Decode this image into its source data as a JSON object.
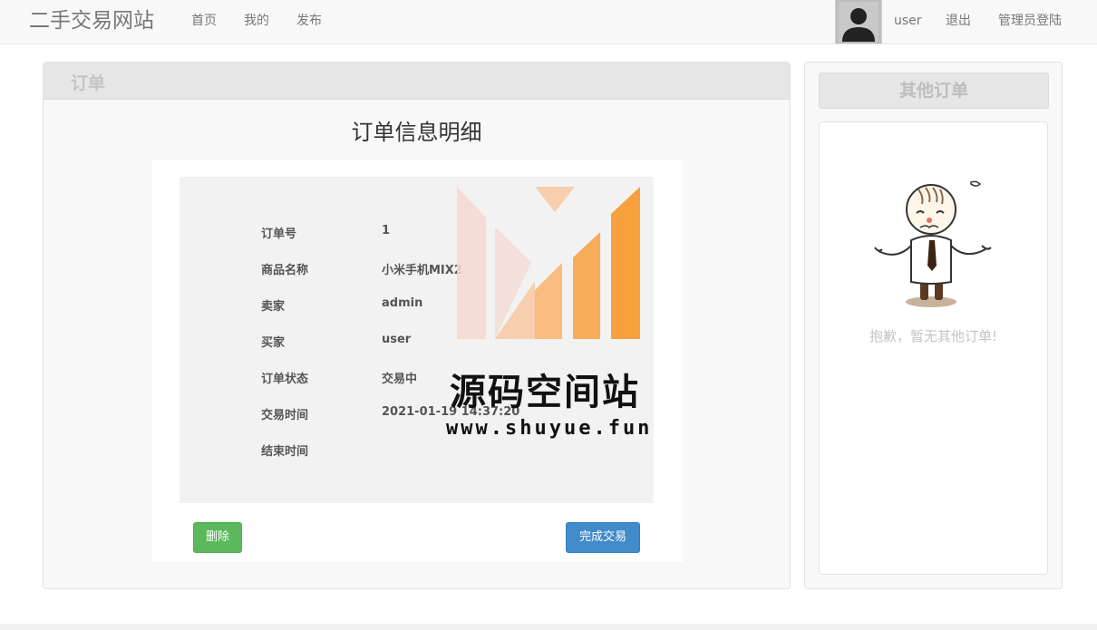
{
  "navbar": {
    "brand": "二手交易网站",
    "links": {
      "home": "首页",
      "mine": "我的",
      "publish": "发布"
    },
    "username": "user",
    "logout": "退出",
    "admin_login": "管理员登陆",
    "avatar_icon": "user-avatar-icon"
  },
  "main_panel": {
    "heading": "订单",
    "title": "订单信息明细",
    "rows": [
      {
        "label": "订单号",
        "value": "1"
      },
      {
        "label": "商品名称",
        "value": "小米手机MIX2"
      },
      {
        "label": "卖家",
        "value": "admin"
      },
      {
        "label": "买家",
        "value": "user"
      },
      {
        "label": "订单状态",
        "value": "交易中"
      },
      {
        "label": "交易时间",
        "value": "2021-01-19 14:37:20"
      },
      {
        "label": "结束时间",
        "value": ""
      }
    ],
    "buttons": {
      "delete": "删除",
      "complete": "完成交易"
    }
  },
  "side_panel": {
    "heading": "其他订单",
    "empty_message": "抱歉，暂无其他订单!",
    "illustration_icon": "shrugging-man-illustration"
  },
  "watermark": {
    "title": "源码空间站",
    "url": "www.shuyue.fun"
  },
  "colors": {
    "delete_button": "#5cb85c",
    "complete_button": "#428bca",
    "navbar_bg": "#f8f8f8",
    "watermark_orange": "#f7931e"
  }
}
